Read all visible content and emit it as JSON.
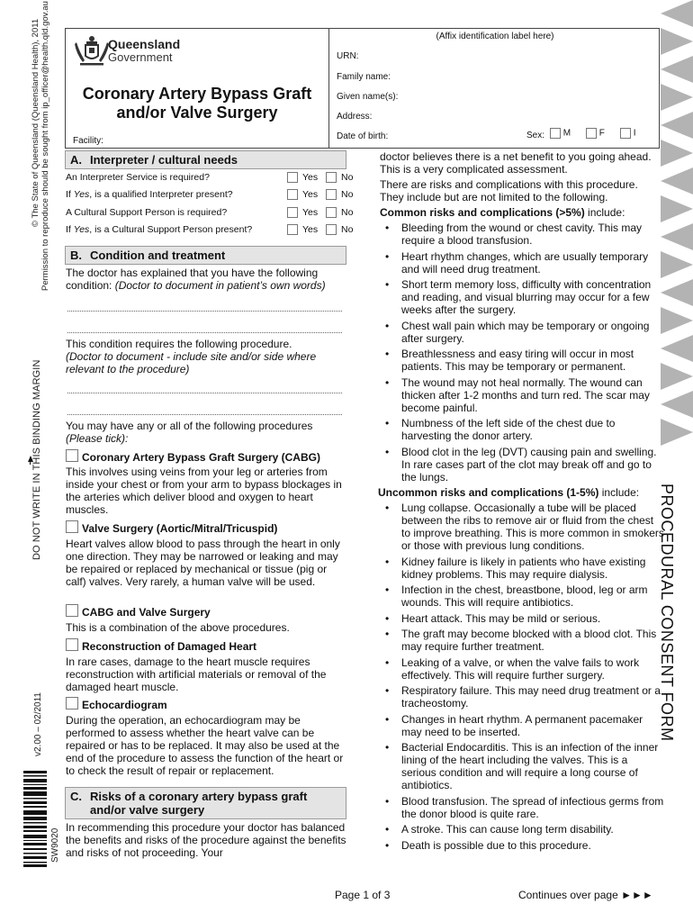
{
  "margin": {
    "copyright": "© The State of Queensland (Queensland Health), 2011",
    "permission": "Permission to reproduce should be sought from ip_officer@health.qld.gov.au",
    "binding": "DO NOT WRITE IN THIS BINDING MARGIN",
    "version": "v2.00 – 02/2011",
    "form_code": "SW9020"
  },
  "header": {
    "org_line1": "Queensland",
    "org_line2": "Government",
    "title_line1": "Coronary Artery Bypass Graft",
    "title_line2": "and/or Valve Surgery",
    "facility_label": "Facility:",
    "affix_label": "(Affix identification label here)",
    "urn_label": "URN:",
    "family_name_label": "Family name:",
    "given_names_label": "Given name(s):",
    "address_label": "Address:",
    "dob_label": "Date of birth:",
    "sex_label": "Sex:",
    "sex_options": [
      "M",
      "F",
      "I"
    ]
  },
  "section_a": {
    "letter": "A.",
    "title": "Interpreter / cultural needs",
    "yes_label": "Yes",
    "no_label": "No",
    "questions": [
      {
        "pre": "",
        "italic": "",
        "text": "An Interpreter Service is required?"
      },
      {
        "pre": "If ",
        "italic": "Yes",
        "text": ", is a qualified Interpreter present?"
      },
      {
        "pre": "",
        "italic": "",
        "text": "A Cultural Support Person is required?"
      },
      {
        "pre": "If ",
        "italic": "Yes",
        "text": ", is a Cultural Support Person present?"
      }
    ]
  },
  "section_b": {
    "letter": "B.",
    "title": "Condition and treatment",
    "condition_intro": "The doctor has explained that you have the following condition: ",
    "condition_note": "(Doctor to document in patient’s own words)",
    "procedure_intro": "This condition requires the following procedure.",
    "procedure_note": "(Doctor to document - include site and/or side where relevant to the procedure)",
    "options_intro": "You may have any or all of the following procedures",
    "options_note": "(Please tick):",
    "procedures": [
      {
        "title": "Coronary Artery Bypass Graft Surgery (CABG)",
        "desc": "This involves using veins from your leg or arteries from inside your chest or from your arm to bypass blockages in the arteries which deliver blood and oxygen to heart muscles."
      },
      {
        "title": "Valve Surgery (Aortic/Mitral/Tricuspid)",
        "desc": "Heart valves allow blood to pass through the heart in only one direction. They may be narrowed or leaking and may be repaired or replaced by mechanical or tissue (pig or calf) valves. Very rarely, a human valve will be used."
      },
      {
        "title": "CABG and Valve Surgery",
        "desc": "This is a combination of the above procedures."
      },
      {
        "title": "Reconstruction of Damaged Heart",
        "desc": "In rare cases, damage to the heart muscle requires reconstruction with artificial materials or removal of the damaged heart muscle."
      },
      {
        "title": "Echocardiogram",
        "desc": "During the operation, an echocardiogram may be performed to assess whether the heart valve can be repaired or has to be replaced. It may also be used at the end of the procedure to assess the function of the heart or to check the result of repair or replacement."
      }
    ]
  },
  "section_c": {
    "letter": "C.",
    "title_line1": "Risks of a coronary artery bypass graft",
    "title_line2": "and/or valve surgery",
    "intro_left": "In recommending this procedure your doctor has balanced the benefits and risks of the procedure against the benefits and risks of not proceeding. Your",
    "intro_right": "doctor believes there is a net benefit to you going ahead. This is a very complicated assessment.",
    "risks_intro": "There are risks and complications with this procedure. They include but are not limited to the following.",
    "common_heading_bold": "Common risks and complications (>5%)",
    "common_heading_rest": " include:",
    "common": [
      "Bleeding from the wound or chest cavity. This may require a blood transfusion.",
      "Heart rhythm changes, which are usually temporary and will need drug treatment.",
      "Short term memory loss, difficulty with concentration and reading, and visual blurring may occur for a few weeks after the surgery.",
      "Chest wall pain which may be temporary or ongoing after surgery.",
      "Breathlessness and easy tiring will occur in most patients. This may be temporary or permanent.",
      "The wound may not heal normally. The wound can thicken after 1-2 months and turn red. The scar may become painful.",
      "Numbness of the left side of the chest due to harvesting the donor artery.",
      "Blood clot in the leg (DVT) causing pain and swelling. In rare cases part of the clot may break off and go to the lungs."
    ],
    "uncommon_heading_bold": "Uncommon risks and complications (1-5%)",
    "uncommon_heading_rest": " include:",
    "uncommon": [
      "Lung collapse. Occasionally a tube will be placed between the ribs to remove air or fluid from the chest to improve breathing. This is more common in smokers or those with previous lung conditions.",
      "Kidney failure is likely in patients who have existing kidney problems. This may require dialysis.",
      "Infection in the chest, breastbone, blood, leg or arm wounds. This will require antibiotics.",
      "Heart attack. This may be mild or serious.",
      "The graft may become blocked with a blood clot. This may require further treatment.",
      "Leaking of a valve, or when the valve fails to work effectively. This will require further surgery.",
      "Respiratory failure. This may need drug treatment or a tracheostomy.",
      "Changes in heart rhythm. A permanent pacemaker may need to be inserted.",
      "Bacterial Endocarditis. This is an infection of the inner lining of the heart including the valves.  This is a serious condition and will require a long course of antibiotics.",
      "Blood transfusion. The spread of infectious germs from the donor blood is quite rare.",
      "A stroke. This can cause long term disability.",
      "Death is possible due to this procedure."
    ]
  },
  "side_label": "PROCEDURAL CONSENT FORM",
  "footer": {
    "page": "Page 1 of 3",
    "continues": "Continues over page ►►►"
  }
}
